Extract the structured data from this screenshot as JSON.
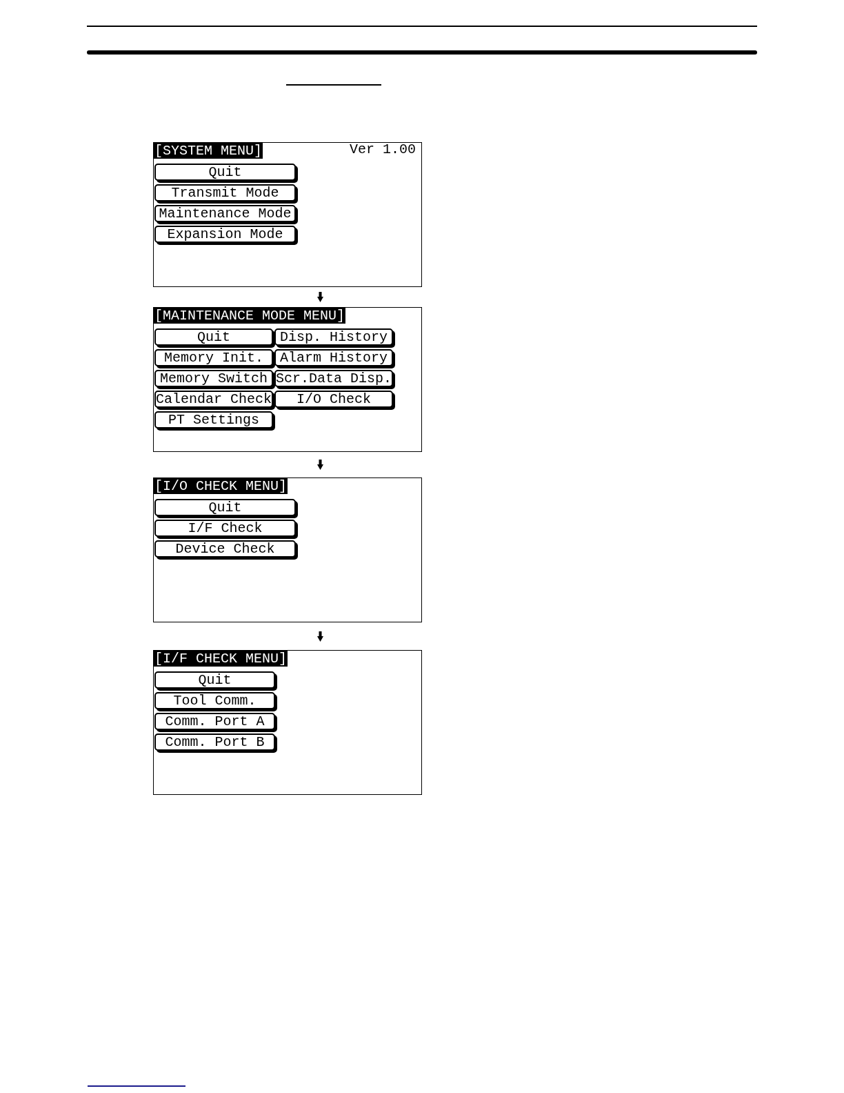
{
  "screens": [
    {
      "title": "[SYSTEM MENU]",
      "version": "Ver 1.00",
      "button_rows": [
        [
          "Quit"
        ],
        [
          "Transmit Mode"
        ],
        [
          "Maintenance Mode"
        ],
        [
          "Expansion Mode"
        ]
      ]
    },
    {
      "title": "[MAINTENANCE MODE MENU]",
      "button_rows": [
        [
          "Quit",
          "Disp. History"
        ],
        [
          "Memory Init.",
          "Alarm History"
        ],
        [
          "Memory Switch",
          "Scr.Data Disp."
        ],
        [
          "Calendar Check",
          "I/O Check"
        ],
        [
          "PT Settings"
        ]
      ]
    },
    {
      "title": "[I/O CHECK MENU]",
      "button_rows": [
        [
          "Quit"
        ],
        [
          "I/F Check"
        ],
        [
          "Device Check"
        ]
      ]
    },
    {
      "title": "[I/F CHECK MENU]",
      "button_rows": [
        [
          "Quit"
        ],
        [
          "Tool Comm."
        ],
        [
          "Comm. Port A"
        ],
        [
          "Comm. Port B"
        ]
      ]
    }
  ]
}
